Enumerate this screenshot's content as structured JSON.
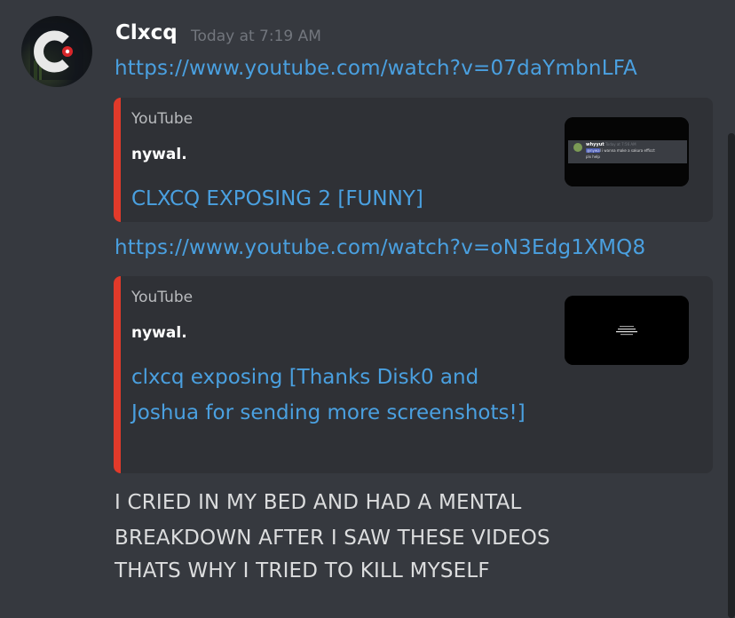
{
  "message": {
    "username": "Clxcq",
    "timestamp": "Today at 7:19 AM",
    "links": [
      "https://www.youtube.com/watch?v=07daYmbnLFA",
      "https://www.youtube.com/watch?v=oN3Edg1XMQ8"
    ],
    "embeds": [
      {
        "provider": "YouTube",
        "author": "nywal.",
        "title": "CLXCQ EXPOSING 2 [FUNNY]",
        "accent_color": "#e23a2a",
        "thumbnail": {
          "name": "whyyut",
          "time": "Today at 7:56 AM",
          "mention": "@nywal",
          "text": "i wanna make a sakura efficct",
          "text2": "plx help"
        }
      },
      {
        "provider": "YouTube",
        "author": "nywal.",
        "title": "clxcq exposing [Thanks Disk0 and Joshua for sending more screenshots!]",
        "accent_color": "#e23a2a"
      }
    ],
    "text_lines": [
      "I CRIED IN MY BED AND HAD A MENTAL BREAKDOWN AFTER I SAW THESE VIDEOS",
      "THATS WHY I TRIED TO KILL MYSELF"
    ]
  },
  "colors": {
    "background": "#36393f",
    "embed_background": "#2f3136",
    "link": "#4aa0e0",
    "embed_accent": "#e23a2a",
    "username": "#ffffff",
    "timestamp": "#72767d",
    "text": "#dcddde"
  }
}
